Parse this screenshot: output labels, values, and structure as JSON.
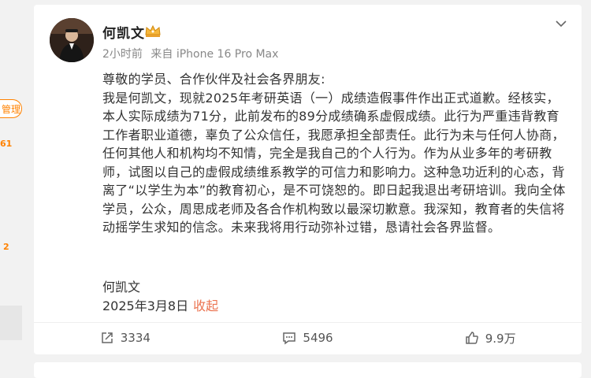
{
  "left_strip": {
    "manage_label": "管理",
    "count1": "61",
    "count2": "2"
  },
  "post": {
    "author": "何凯文",
    "time": "2小时前",
    "source": "来自 iPhone 16 Pro Max",
    "greeting": "尊敬的学员、合作伙伴及社会各界朋友:",
    "paragraph": "我是何凯文，现就2025年考研英语（一）成绩造假事件作出正式道歉。经核实，本人实际成绩为71分，此前发布的89分成绩确系虚假成绩。此行为严重违背教育工作者职业道德，辜负了公众信任，我愿承担全部责任。此行为未与任何人协商，任何其他人和机构均不知情，完全是我自己的个人行为。作为从业多年的考研教师，试图以自己的虚假成绩维系教学的可信力和影响力。这种急功近利的心态，背离了“以学生为本”的教育初心，是不可饶恕的。即日起我退出考研培训。我向全体学员，公众，周思成老师及各合作机构致以最深切歉意。我深知，教育者的失信将动摇学生求知的信念。未来我将用行动弥补过错，恳请社会各界监督。",
    "signature": "何凯文",
    "date": "2025年3月8日",
    "collapse": "收起"
  },
  "actions": {
    "repost": "3334",
    "comment": "5496",
    "like": "9.9万"
  },
  "colors": {
    "accent": "#ff8200",
    "link": "#eb7350"
  }
}
